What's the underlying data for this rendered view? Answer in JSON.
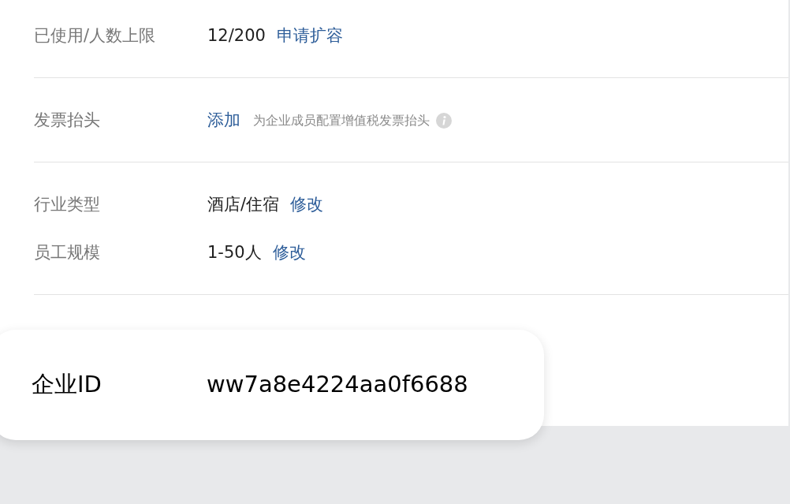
{
  "groups": [
    {
      "rows": [
        {
          "label": "已使用/人数上限",
          "value": "12/200",
          "link": "申请扩容"
        }
      ]
    },
    {
      "rows": [
        {
          "label": "发票抬头",
          "link": "添加",
          "hint": "为企业成员配置增值税发票抬头",
          "info": true
        }
      ]
    },
    {
      "rows": [
        {
          "label": "行业类型",
          "value": "酒店/住宿",
          "link": "修改"
        },
        {
          "label": "员工规模",
          "value": "1-50人",
          "link": "修改"
        }
      ]
    }
  ],
  "id_card": {
    "label": "企业ID",
    "value": "ww7a8e4224aa0f6688"
  }
}
